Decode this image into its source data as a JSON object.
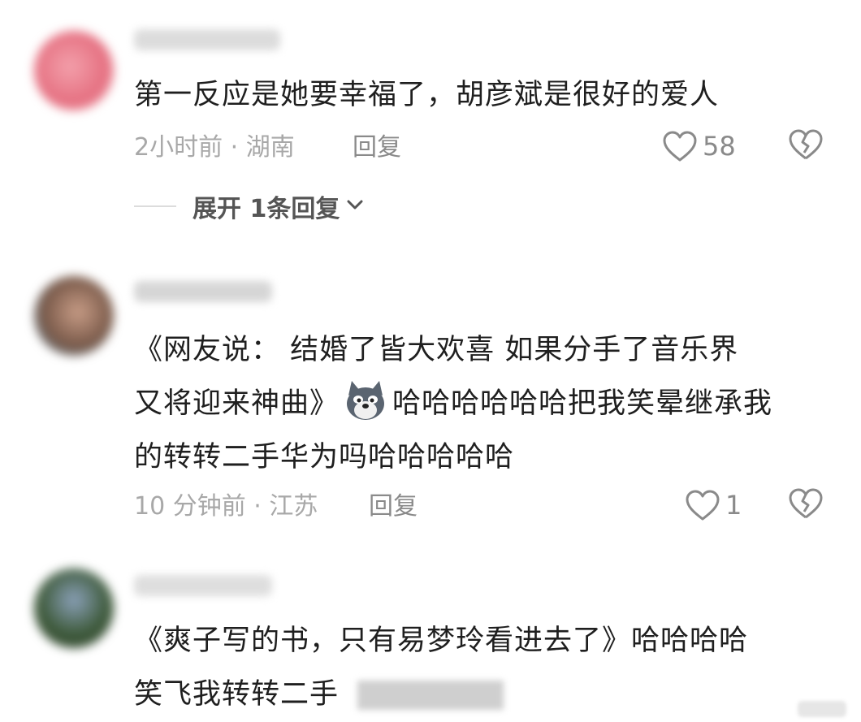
{
  "comments": [
    {
      "text_lines": [
        "第一反应是她要幸福了，胡彦斌是很好的爱人"
      ],
      "meta": "2小时前 · 湖南",
      "reply_label": "回复",
      "like_count": "58",
      "expand_label": "展开 1条回复"
    },
    {
      "text_lines": [
        "《网友说：  结婚了皆大欢喜 如果分手了音乐界",
        "又将迎来神曲》",
        "的转转二手华为吗哈哈哈哈哈"
      ],
      "emoji_trailing": "哈哈哈哈哈哈把我笑晕继承我",
      "meta": "10 分钟前 · 江苏",
      "reply_label": "回复",
      "like_count": "1"
    },
    {
      "text_lines": [
        "《爽子写的书，只有易梦玲看进去了》哈哈哈哈",
        "笑飞我转转二手"
      ]
    }
  ],
  "icons": {
    "like": "heart-outline-icon",
    "dislike": "broken-heart-icon",
    "expand": "chevron-down-icon",
    "emoji": "wolf-emoji-icon"
  },
  "colors": {
    "text": "#1f1f1f",
    "meta": "#a8a8a8",
    "action": "#8a8a8a"
  }
}
